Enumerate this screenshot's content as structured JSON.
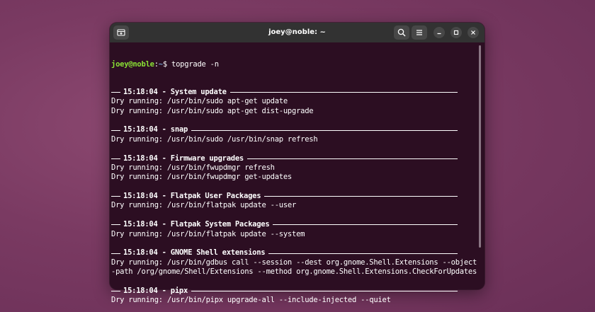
{
  "window": {
    "title": "joey@noble: ~",
    "buttons": {
      "new_tab_icon": "new-tab-icon",
      "search_icon": "search-icon",
      "menu_icon": "hamburger-menu-icon",
      "minimize_icon": "minimize-icon",
      "maximize_icon": "maximize-icon",
      "close_icon": "close-icon"
    }
  },
  "terminal": {
    "prompt_user": "joey@noble",
    "prompt_sep": ":",
    "prompt_dir": "~",
    "prompt_symbol": "$ ",
    "command": "topgrade -n",
    "colors": {
      "background": "#2c0e22",
      "prompt_user": "#8ae234",
      "prompt_dir": "#729fcf",
      "text": "#ffffff"
    },
    "sections": [
      {
        "header": "15:18:04 - System update",
        "lines": [
          "Dry running: /usr/bin/sudo apt-get update",
          "Dry running: /usr/bin/sudo apt-get dist-upgrade"
        ]
      },
      {
        "header": "15:18:04 - snap",
        "lines": [
          "Dry running: /usr/bin/sudo /usr/bin/snap refresh"
        ]
      },
      {
        "header": "15:18:04 - Firmware upgrades",
        "lines": [
          "Dry running: /usr/bin/fwupdmgr refresh",
          "Dry running: /usr/bin/fwupdmgr get-updates"
        ]
      },
      {
        "header": "15:18:04 - Flatpak User Packages",
        "lines": [
          "Dry running: /usr/bin/flatpak update --user"
        ]
      },
      {
        "header": "15:18:04 - Flatpak System Packages",
        "lines": [
          "Dry running: /usr/bin/flatpak update --system"
        ]
      },
      {
        "header": "15:18:04 - GNOME Shell extensions",
        "lines": [
          "Dry running: /usr/bin/gdbus call --session --dest org.gnome.Shell.Extensions --object",
          "-path /org/gnome/Shell/Extensions --method org.gnome.Shell.Extensions.CheckForUpdates"
        ]
      },
      {
        "header": "15:18:04 - pipx",
        "lines": [
          "Dry running: /usr/bin/pipx upgrade-all --include-injected --quiet"
        ]
      }
    ]
  }
}
